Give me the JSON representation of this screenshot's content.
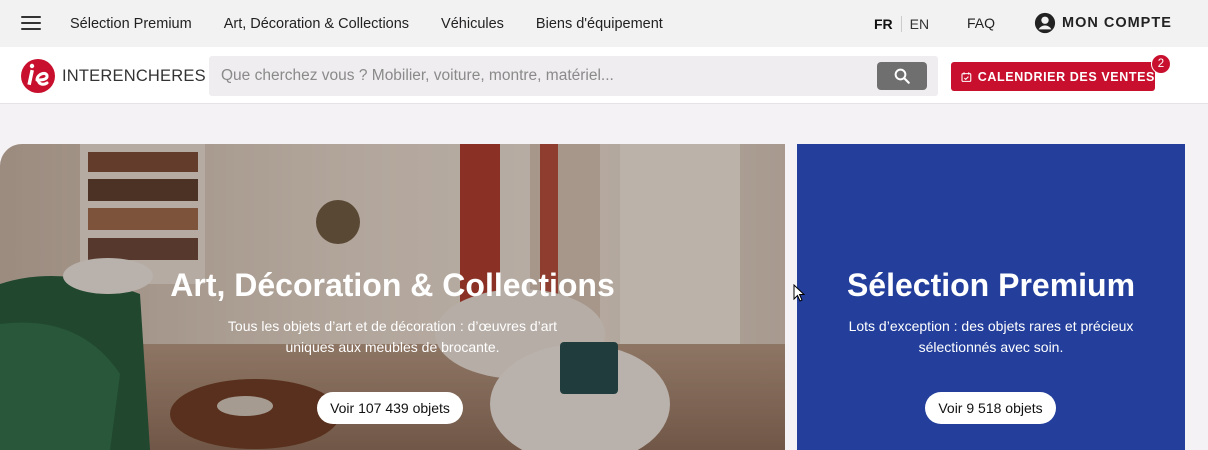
{
  "topnav": {
    "menu_icon": "hamburger-menu-icon",
    "links": [
      "Sélection Premium",
      "Art, Décoration & Collections",
      "Véhicules",
      "Biens d'équipement"
    ],
    "lang_fr": "FR",
    "lang_en": "EN",
    "faq": "FAQ",
    "account_icon": "account-circle-icon",
    "account_label": "MON COMPTE"
  },
  "header": {
    "logo_text": "INTERENCHERES",
    "search_placeholder": "Que cherchez vous ? Mobilier, voiture, montre, matériel...",
    "search_icon": "search-icon",
    "calendar_icon": "calendar-check-icon",
    "calendar_label": "CALENDRIER DES VENTES",
    "calendar_badge": "2"
  },
  "hero": {
    "art": {
      "title": "Art, Décoration & Collections",
      "desc_line1": "Tous les objets d’art et de décoration : d’œuvres d’art",
      "desc_line2": "uniques aux meubles de brocante.",
      "button": "Voir 107 439 objets"
    },
    "premium": {
      "title": "Sélection Premium",
      "desc_line1": "Lots d’exception : des objets rares et précieux",
      "desc_line2": "sélectionnés avec soin.",
      "button": "Voir 9 518 objets",
      "color": "#233f9b"
    }
  },
  "colors": {
    "brand_red": "#c8102e",
    "premium_blue": "#233f9b"
  }
}
